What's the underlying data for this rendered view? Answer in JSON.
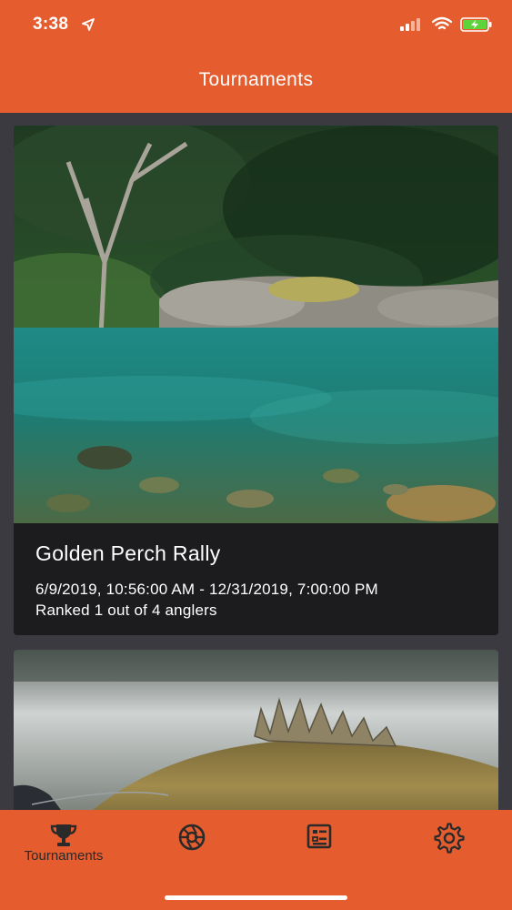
{
  "status_bar": {
    "time": "3:38",
    "location_icon": "location-arrow-icon",
    "signal_icon": "cellular-signal-icon",
    "wifi_icon": "wifi-icon",
    "battery_icon": "battery-charging-icon"
  },
  "header": {
    "title": "Tournaments"
  },
  "tournaments": [
    {
      "title": "Golden Perch Rally",
      "dates": "6/9/2019, 10:56:00 AM - 12/31/2019, 7:00:00 PM",
      "rank": "Ranked 1 out of 4 anglers"
    }
  ],
  "tabbar": {
    "items": [
      {
        "label": "Tournaments",
        "icon": "trophy-icon",
        "active": true
      },
      {
        "label": "",
        "icon": "camera-aperture-icon",
        "active": false
      },
      {
        "label": "",
        "icon": "leaderboard-list-icon",
        "active": false
      },
      {
        "label": "",
        "icon": "gear-icon",
        "active": false
      }
    ]
  },
  "colors": {
    "brand": "#e55d2f",
    "background": "#3a3a40",
    "card": "#1c1c1e",
    "text_light": "#ffffff",
    "tab_text": "#2a2a2a"
  }
}
